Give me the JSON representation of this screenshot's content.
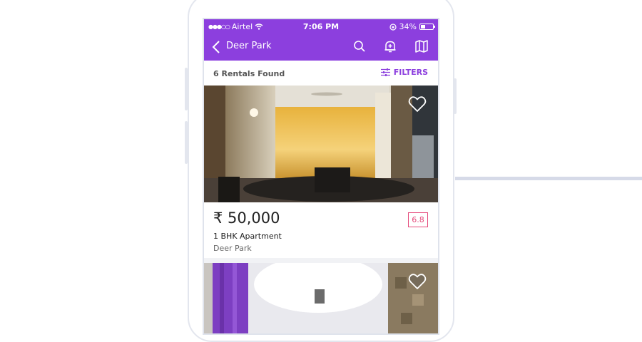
{
  "status_bar": {
    "carrier": "Airtel",
    "time": "7:06 PM",
    "battery": "34%"
  },
  "header": {
    "title": "Deer Park",
    "icons": [
      "back-chevron-icon",
      "search-icon",
      "notification-add-icon",
      "map-icon"
    ]
  },
  "subbar": {
    "count": "6 Rentals Found",
    "filters_label": "FILTERS"
  },
  "listings": [
    {
      "price": "₹ 50,000",
      "type": "1 BHK Apartment",
      "location": "Deer Park",
      "rating": "6.8"
    }
  ],
  "colors": {
    "brand": "#8c3fde",
    "rating": "#e54a7b"
  }
}
